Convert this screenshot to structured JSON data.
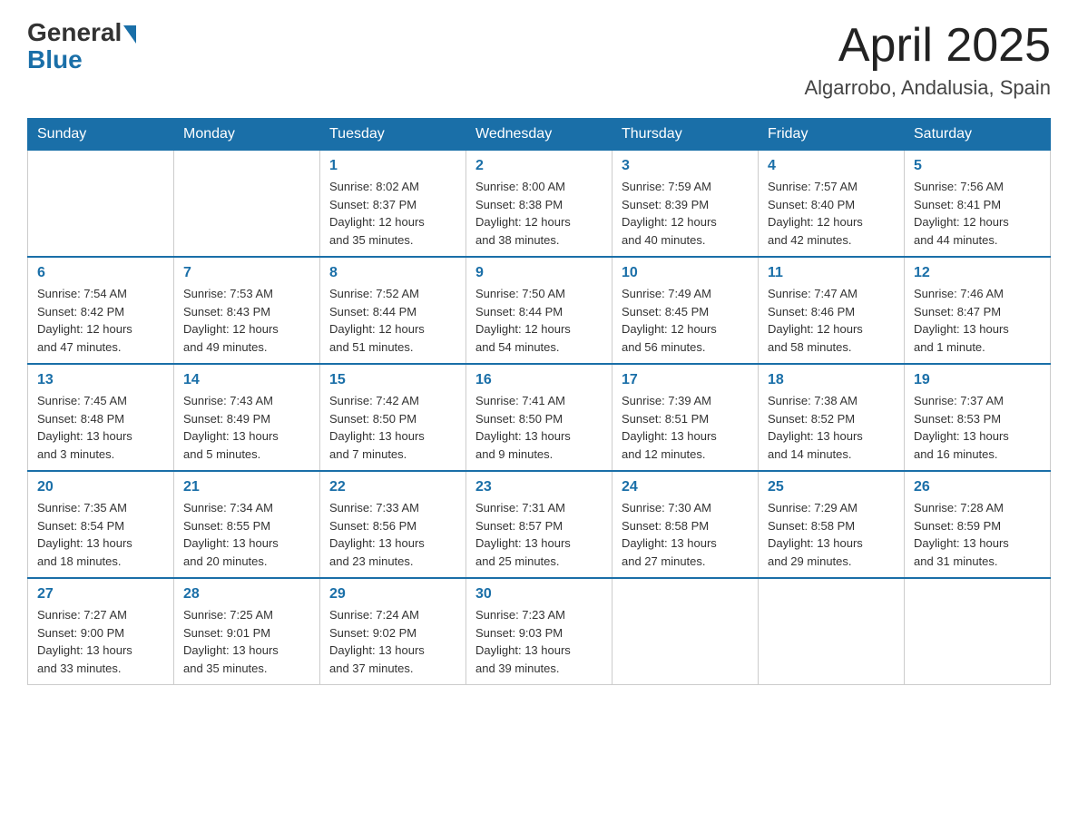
{
  "header": {
    "logo_general": "General",
    "logo_blue": "Blue",
    "month": "April 2025",
    "location": "Algarrobo, Andalusia, Spain"
  },
  "weekdays": [
    "Sunday",
    "Monday",
    "Tuesday",
    "Wednesday",
    "Thursday",
    "Friday",
    "Saturday"
  ],
  "weeks": [
    [
      {
        "day": "",
        "info": ""
      },
      {
        "day": "",
        "info": ""
      },
      {
        "day": "1",
        "info": "Sunrise: 8:02 AM\nSunset: 8:37 PM\nDaylight: 12 hours\nand 35 minutes."
      },
      {
        "day": "2",
        "info": "Sunrise: 8:00 AM\nSunset: 8:38 PM\nDaylight: 12 hours\nand 38 minutes."
      },
      {
        "day": "3",
        "info": "Sunrise: 7:59 AM\nSunset: 8:39 PM\nDaylight: 12 hours\nand 40 minutes."
      },
      {
        "day": "4",
        "info": "Sunrise: 7:57 AM\nSunset: 8:40 PM\nDaylight: 12 hours\nand 42 minutes."
      },
      {
        "day": "5",
        "info": "Sunrise: 7:56 AM\nSunset: 8:41 PM\nDaylight: 12 hours\nand 44 minutes."
      }
    ],
    [
      {
        "day": "6",
        "info": "Sunrise: 7:54 AM\nSunset: 8:42 PM\nDaylight: 12 hours\nand 47 minutes."
      },
      {
        "day": "7",
        "info": "Sunrise: 7:53 AM\nSunset: 8:43 PM\nDaylight: 12 hours\nand 49 minutes."
      },
      {
        "day": "8",
        "info": "Sunrise: 7:52 AM\nSunset: 8:44 PM\nDaylight: 12 hours\nand 51 minutes."
      },
      {
        "day": "9",
        "info": "Sunrise: 7:50 AM\nSunset: 8:44 PM\nDaylight: 12 hours\nand 54 minutes."
      },
      {
        "day": "10",
        "info": "Sunrise: 7:49 AM\nSunset: 8:45 PM\nDaylight: 12 hours\nand 56 minutes."
      },
      {
        "day": "11",
        "info": "Sunrise: 7:47 AM\nSunset: 8:46 PM\nDaylight: 12 hours\nand 58 minutes."
      },
      {
        "day": "12",
        "info": "Sunrise: 7:46 AM\nSunset: 8:47 PM\nDaylight: 13 hours\nand 1 minute."
      }
    ],
    [
      {
        "day": "13",
        "info": "Sunrise: 7:45 AM\nSunset: 8:48 PM\nDaylight: 13 hours\nand 3 minutes."
      },
      {
        "day": "14",
        "info": "Sunrise: 7:43 AM\nSunset: 8:49 PM\nDaylight: 13 hours\nand 5 minutes."
      },
      {
        "day": "15",
        "info": "Sunrise: 7:42 AM\nSunset: 8:50 PM\nDaylight: 13 hours\nand 7 minutes."
      },
      {
        "day": "16",
        "info": "Sunrise: 7:41 AM\nSunset: 8:50 PM\nDaylight: 13 hours\nand 9 minutes."
      },
      {
        "day": "17",
        "info": "Sunrise: 7:39 AM\nSunset: 8:51 PM\nDaylight: 13 hours\nand 12 minutes."
      },
      {
        "day": "18",
        "info": "Sunrise: 7:38 AM\nSunset: 8:52 PM\nDaylight: 13 hours\nand 14 minutes."
      },
      {
        "day": "19",
        "info": "Sunrise: 7:37 AM\nSunset: 8:53 PM\nDaylight: 13 hours\nand 16 minutes."
      }
    ],
    [
      {
        "day": "20",
        "info": "Sunrise: 7:35 AM\nSunset: 8:54 PM\nDaylight: 13 hours\nand 18 minutes."
      },
      {
        "day": "21",
        "info": "Sunrise: 7:34 AM\nSunset: 8:55 PM\nDaylight: 13 hours\nand 20 minutes."
      },
      {
        "day": "22",
        "info": "Sunrise: 7:33 AM\nSunset: 8:56 PM\nDaylight: 13 hours\nand 23 minutes."
      },
      {
        "day": "23",
        "info": "Sunrise: 7:31 AM\nSunset: 8:57 PM\nDaylight: 13 hours\nand 25 minutes."
      },
      {
        "day": "24",
        "info": "Sunrise: 7:30 AM\nSunset: 8:58 PM\nDaylight: 13 hours\nand 27 minutes."
      },
      {
        "day": "25",
        "info": "Sunrise: 7:29 AM\nSunset: 8:58 PM\nDaylight: 13 hours\nand 29 minutes."
      },
      {
        "day": "26",
        "info": "Sunrise: 7:28 AM\nSunset: 8:59 PM\nDaylight: 13 hours\nand 31 minutes."
      }
    ],
    [
      {
        "day": "27",
        "info": "Sunrise: 7:27 AM\nSunset: 9:00 PM\nDaylight: 13 hours\nand 33 minutes."
      },
      {
        "day": "28",
        "info": "Sunrise: 7:25 AM\nSunset: 9:01 PM\nDaylight: 13 hours\nand 35 minutes."
      },
      {
        "day": "29",
        "info": "Sunrise: 7:24 AM\nSunset: 9:02 PM\nDaylight: 13 hours\nand 37 minutes."
      },
      {
        "day": "30",
        "info": "Sunrise: 7:23 AM\nSunset: 9:03 PM\nDaylight: 13 hours\nand 39 minutes."
      },
      {
        "day": "",
        "info": ""
      },
      {
        "day": "",
        "info": ""
      },
      {
        "day": "",
        "info": ""
      }
    ]
  ]
}
